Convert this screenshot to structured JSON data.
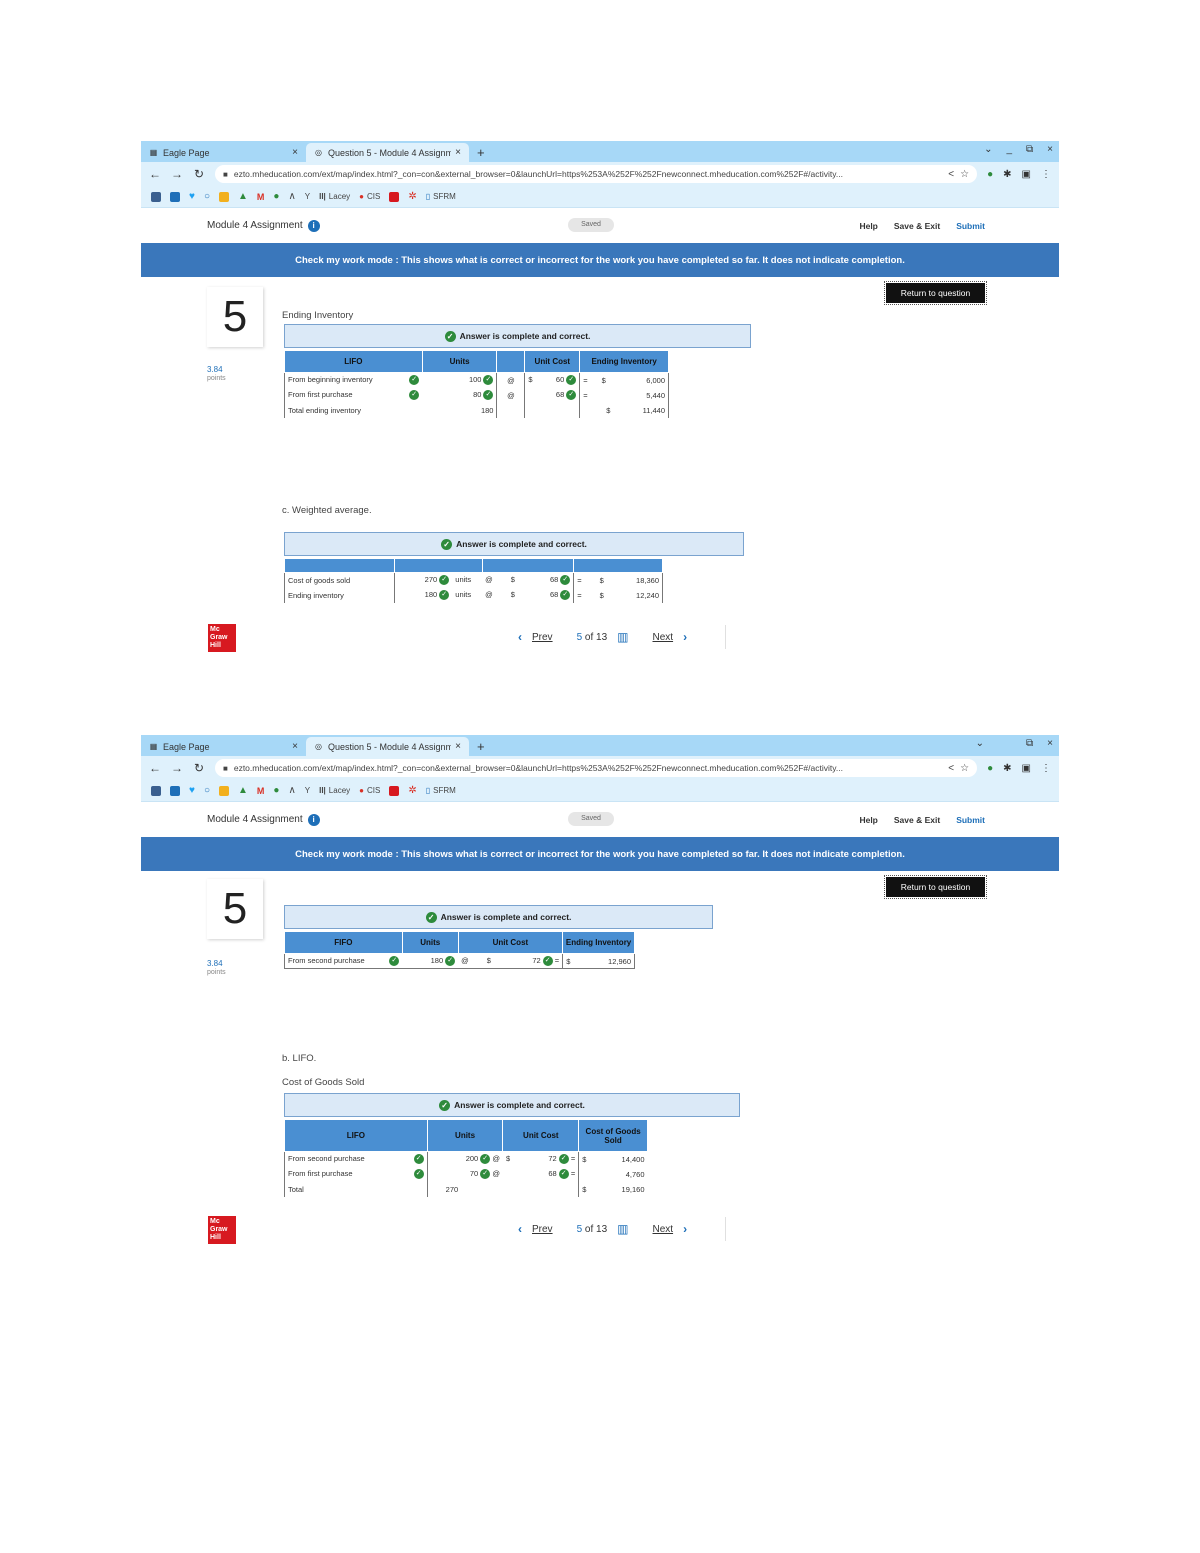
{
  "browser": {
    "tabs": [
      {
        "title": "Eagle Page",
        "icon": "calendar-icon",
        "close": "×"
      },
      {
        "title": "Question 5 - Module 4 Assignm",
        "icon": "globe-icon",
        "close": "×"
      }
    ],
    "new_tab": "+",
    "window_controls_1": [
      "⌄",
      "_",
      "⧉",
      "×"
    ],
    "window_controls_2": [
      "⌄",
      "⧉",
      "×"
    ],
    "url": "ezto.mheducation.com/ext/map/index.html?_con=con&external_browser=0&launchUrl=https%253A%252F%252Fnewconnect.mheducation.com%252F#/activity...",
    "bookmarks": [
      "",
      "",
      "",
      "",
      "",
      "",
      "",
      "",
      "",
      "",
      "Y",
      "Lacey",
      "CIS",
      "",
      "",
      "SFRM"
    ],
    "accent": "#a7d8f7"
  },
  "header": {
    "assignment_title": "Module 4 Assignment",
    "info": "i",
    "saved": "Saved",
    "help": "Help",
    "save_exit": "Save & Exit",
    "submit": "Submit"
  },
  "banner": {
    "text": "Check my work mode : This shows what is correct or incorrect for the work you have completed so far. It does not indicate completion.",
    "color": "#3a77bb"
  },
  "question": {
    "number": "5",
    "points_value": "3.84",
    "points_label": "points",
    "return_label": "Return to question"
  },
  "answer_status": "Answer is complete and correct.",
  "shot1": {
    "section_label": "Ending Inventory",
    "lifo_table": {
      "headers": [
        "LIFO",
        "Units",
        "",
        "Unit Cost",
        "Ending Inventory"
      ],
      "rows": [
        {
          "label": "From beginning inventory",
          "units": "100",
          "op": "@",
          "cur": "$",
          "cost": "60",
          "eq": "=",
          "cur2": "$",
          "total": "6,000"
        },
        {
          "label": "From first purchase",
          "units": "80",
          "op": "@",
          "cur": "",
          "cost": "68",
          "eq": "=",
          "cur2": "",
          "total": "5,440"
        },
        {
          "label": "Total ending inventory",
          "units": "180",
          "op": "",
          "cur": "",
          "cost": "",
          "eq": "",
          "cur2": "$",
          "total": "11,440"
        }
      ]
    },
    "weighted_label": "c. Weighted average.",
    "weighted_table": {
      "rows": [
        {
          "label": "Cost of goods sold",
          "units": "270",
          "unit_word": "units",
          "op": "@",
          "cur": "$",
          "cost": "68",
          "eq": "=",
          "cur2": "$",
          "total": "18,360"
        },
        {
          "label": "Ending inventory",
          "units": "180",
          "unit_word": "units",
          "op": "@",
          "cur": "$",
          "cost": "68",
          "eq": "=",
          "cur2": "$",
          "total": "12,240"
        }
      ]
    }
  },
  "shot2": {
    "fifo_table": {
      "headers": [
        "FIFO",
        "Units",
        "Unit Cost",
        "Ending Inventory"
      ],
      "rows": [
        {
          "label": "From second purchase",
          "units": "180",
          "op": "@",
          "cur": "$",
          "cost": "72",
          "eq": "=",
          "cur2": "$",
          "total": "12,960"
        }
      ]
    },
    "lifo_label": "b. LIFO.",
    "cogs_label": "Cost of Goods Sold",
    "cogs_table": {
      "headers": [
        "LIFO",
        "Units",
        "Unit Cost",
        "Cost of Goods Sold"
      ],
      "rows": [
        {
          "label": "From second purchase",
          "units": "200",
          "op": "@",
          "cur": "$",
          "cost": "72",
          "eq": "=",
          "cur2": "$",
          "total": "14,400"
        },
        {
          "label": "From first purchase",
          "units": "70",
          "op": "@",
          "cur": "",
          "cost": "68",
          "eq": "=",
          "cur2": "",
          "total": "4,760"
        },
        {
          "label": "Total",
          "units": "270",
          "op": "",
          "cur": "",
          "cost": "",
          "eq": "",
          "cur2": "$",
          "total": "19,160"
        }
      ]
    }
  },
  "pager": {
    "prev": "Prev",
    "current": "5",
    "of": "of",
    "total": "13",
    "next": "Next"
  },
  "logo": {
    "line1": "Mc",
    "line2": "Graw",
    "line3": "Hill",
    "color": "#d71920"
  }
}
